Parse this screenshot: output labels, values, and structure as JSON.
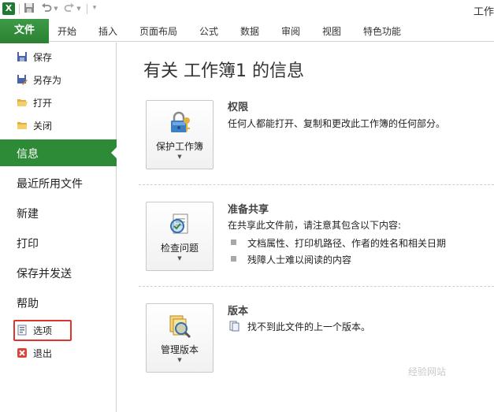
{
  "app": {
    "icon_label": "X",
    "title_partial": "工作"
  },
  "quick_access": {
    "save_icon": "save-icon",
    "undo_icon": "undo-icon",
    "redo_icon": "redo-icon",
    "customize_icon": "customize-icon"
  },
  "ribbon_tabs": {
    "file": "文件",
    "home": "开始",
    "insert": "插入",
    "page_layout": "页面布局",
    "formulas": "公式",
    "data": "数据",
    "review": "审阅",
    "view": "视图",
    "special": "特色功能"
  },
  "nav": {
    "save": "保存",
    "save_as": "另存为",
    "open": "打开",
    "close": "关闭",
    "info": "信息",
    "recent": "最近所用文件",
    "new": "新建",
    "print": "打印",
    "save_send": "保存并发送",
    "help": "帮助",
    "options": "选项",
    "exit": "退出"
  },
  "main": {
    "title": "有关 工作簿1 的信息",
    "permissions": {
      "button_label": "保护工作簿",
      "heading": "权限",
      "text": "任何人都能打开、复制和更改此工作簿的任何部分。"
    },
    "prepare": {
      "button_label": "检查问题",
      "heading": "准备共享",
      "text": "在共享此文件前，请注意其包含以下内容:",
      "bullets": [
        "文档属性、打印机路径、作者的姓名和相关日期",
        "残障人士难以阅读的内容"
      ]
    },
    "versions": {
      "button_label": "管理版本",
      "heading": "版本",
      "text": "找不到此文件的上一个版本。"
    }
  },
  "watermark": "经验网站",
  "colors": {
    "accent_green": "#2d8a36",
    "highlight_red": "#e0342f"
  }
}
